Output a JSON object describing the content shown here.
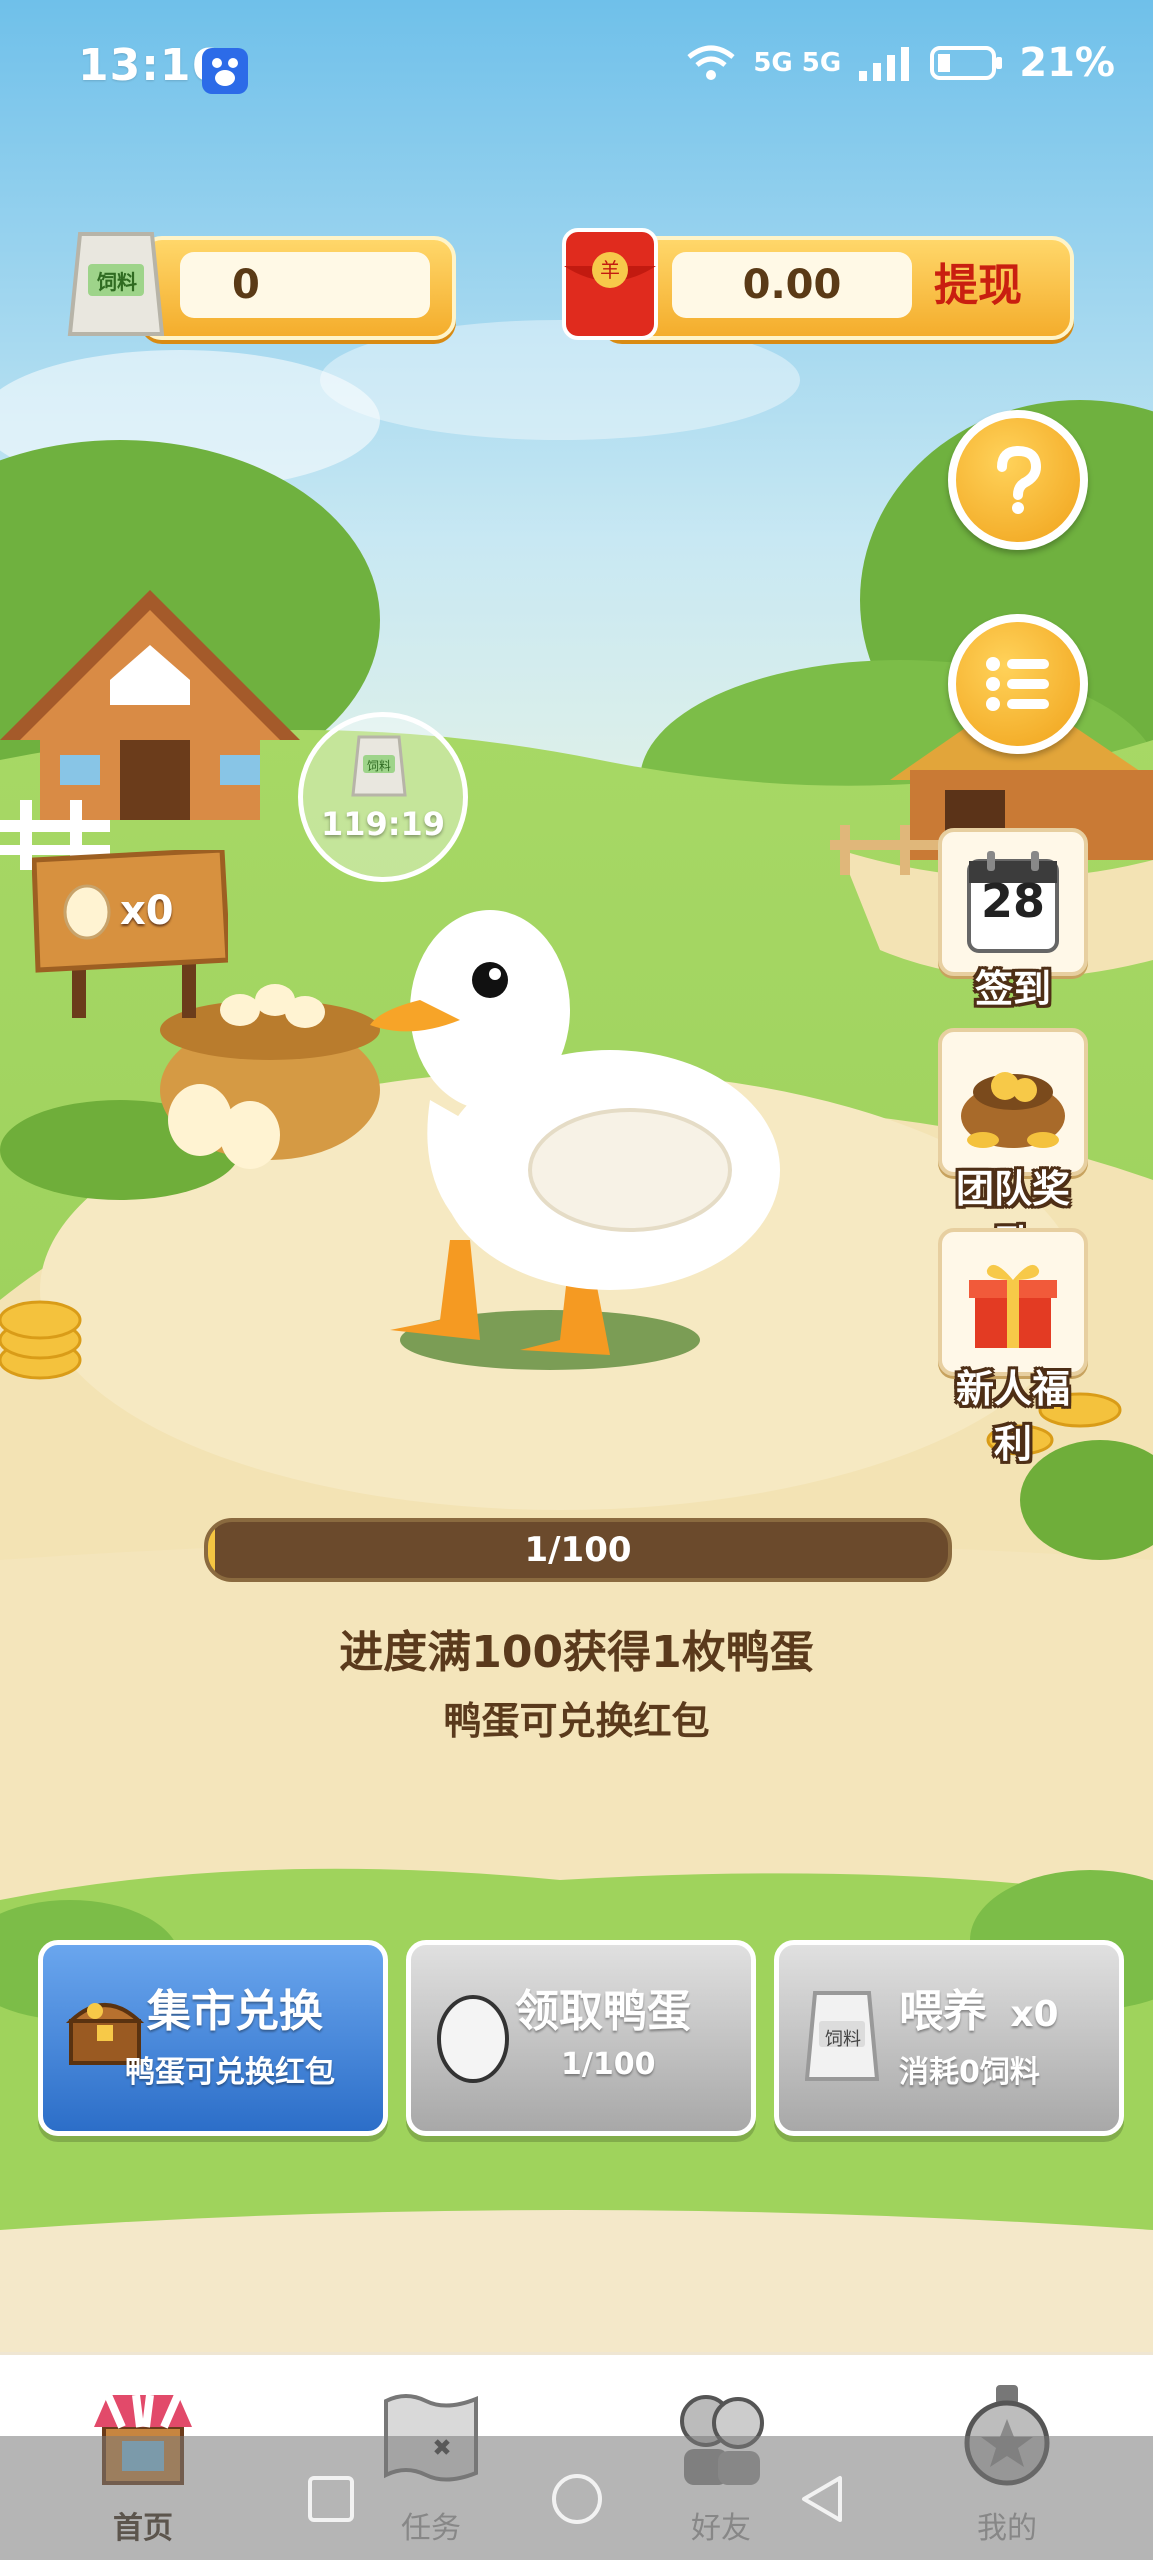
{
  "status_bar": {
    "time": "13:16",
    "signal_text": "5G 5G",
    "battery": "21%"
  },
  "top": {
    "feed_count": "0",
    "feed_icon_text": "饲料",
    "money": "0.00",
    "withdraw_label": "提现"
  },
  "timer": {
    "icon_text": "饲料",
    "value": "119:19"
  },
  "eggs_sign": {
    "count": "x0"
  },
  "side_menu": [
    {
      "label": "签到",
      "icon": "calendar-icon",
      "icon_text": "28"
    },
    {
      "label": "团队奖励",
      "icon": "treasure-bag-icon"
    },
    {
      "label": "新人福利",
      "icon": "gift-box-icon"
    }
  ],
  "progress": {
    "text": "1/100",
    "fraction": 0.01
  },
  "hints": {
    "line1": "进度满100获得1枚鸭蛋",
    "line2": "鸭蛋可兑换红包"
  },
  "actions": {
    "market": {
      "title": "集市兑换",
      "subtitle": "鸭蛋可兑换红包"
    },
    "collect": {
      "title": "领取鸭蛋",
      "subtitle": "1/100"
    },
    "feed": {
      "title": "喂养",
      "count": "x0",
      "subtitle": "消耗0饲料",
      "icon_text": "饲料"
    }
  },
  "nav": [
    {
      "label": "首页",
      "active": true
    },
    {
      "label": "任务",
      "active": false
    },
    {
      "label": "好友",
      "active": false
    },
    {
      "label": "我的",
      "active": false
    }
  ],
  "colors": {
    "accent_orange": "#f4ad2c",
    "withdraw_red": "#c91f10",
    "button_blue": "#2c6ec8",
    "button_grey": "#a8a8a8",
    "text_brown": "#5a3a1c"
  }
}
